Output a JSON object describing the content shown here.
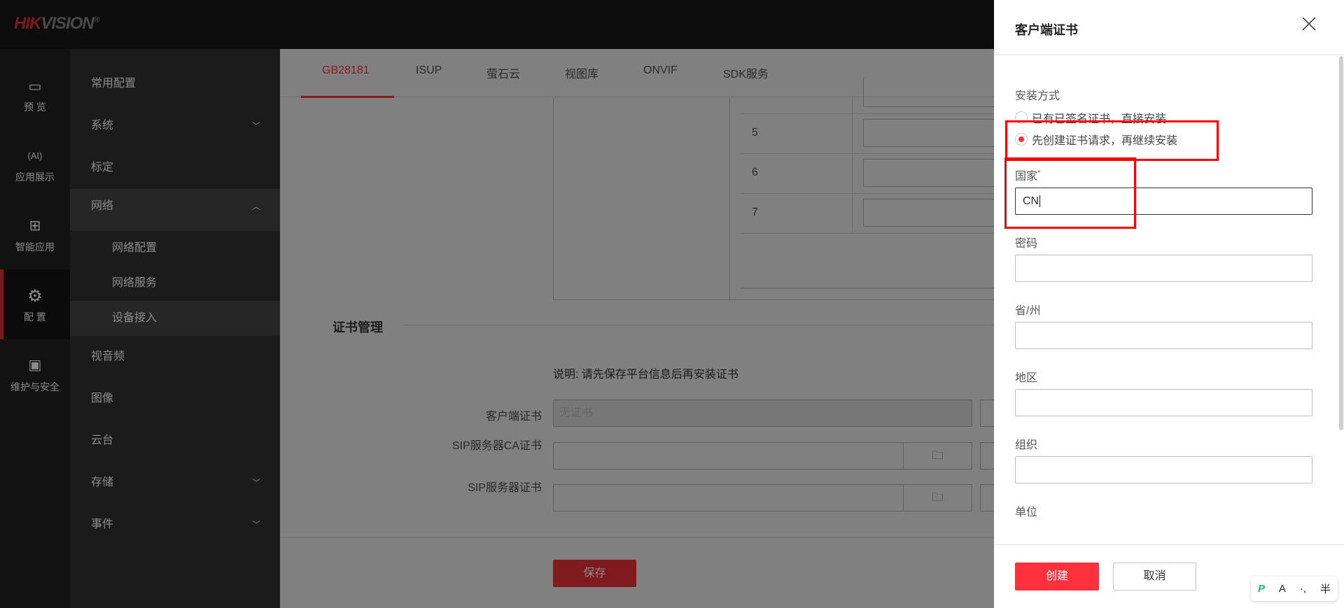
{
  "header": {
    "logo_red": "HIK",
    "logo_grey": "VISION",
    "logo_mark": "®"
  },
  "iconbar": [
    {
      "label": "预 览",
      "icon": "camera-icon"
    },
    {
      "label": "应用展示",
      "icon": "ai-head-icon"
    },
    {
      "label": "智能应用",
      "icon": "apps-grid-icon"
    },
    {
      "label": "配 置",
      "icon": "gear-icon",
      "active": true
    },
    {
      "label": "维护与安全",
      "icon": "maintenance-icon"
    }
  ],
  "menu": {
    "items": [
      "常用配置",
      "系统",
      "标定",
      "网络",
      "视音频",
      "图像",
      "云台",
      "存储",
      "事件"
    ],
    "network_sub": [
      "网络配置",
      "网络服务",
      "设备接入"
    ]
  },
  "tabs": [
    "GB28181",
    "ISUP",
    "萤石云",
    "视图库",
    "ONVIF",
    "SDK服务"
  ],
  "table": {
    "rows": [
      "5",
      "6",
      "7"
    ]
  },
  "cert": {
    "section_title": "证书管理",
    "note": "说明: 请先保存平台信息后再安装证书",
    "client_label": "客户端证书",
    "client_value": "无证书",
    "ca_label": "SIP服务器CA证书",
    "server_label": "SIP服务器证书",
    "save": "保存"
  },
  "drawer": {
    "title": "客户端证书",
    "install_label": "安装方式",
    "option1": "已有已签名证书，直接安装",
    "option2": "先创建证书请求，再继续安装",
    "selected": "option2",
    "country_label": "国家",
    "required_mark": "*",
    "country_value": "CN",
    "password_label": "密码",
    "province_label": "省/州",
    "region_label": "地区",
    "org_label": "组织",
    "unit_label": "单位",
    "create": "创建",
    "cancel": "取消"
  },
  "ime": {
    "logo": "P",
    "mode": "A",
    "punct": "·,",
    "width": "半"
  },
  "colors": {
    "accent": "#ff313c",
    "annotation": "#ff0000"
  }
}
